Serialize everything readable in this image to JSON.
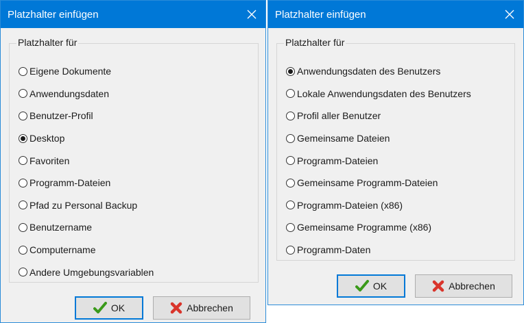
{
  "dialog_left": {
    "title": "Platzhalter einfügen",
    "group_label": "Platzhalter für",
    "options": [
      {
        "label": "Eigene Dokumente",
        "selected": false
      },
      {
        "label": "Anwendungsdaten",
        "selected": false
      },
      {
        "label": "Benutzer-Profil",
        "selected": false
      },
      {
        "label": "Desktop",
        "selected": true
      },
      {
        "label": "Favoriten",
        "selected": false
      },
      {
        "label": "Programm-Dateien",
        "selected": false
      },
      {
        "label": "Pfad zu Personal Backup",
        "selected": false
      },
      {
        "label": "Benutzername",
        "selected": false
      },
      {
        "label": "Computername",
        "selected": false
      },
      {
        "label": "Andere Umgebungsvariablen",
        "selected": false
      }
    ],
    "ok_label": "OK",
    "cancel_label": "Abbrechen"
  },
  "dialog_right": {
    "title": "Platzhalter einfügen",
    "group_label": "Platzhalter für",
    "options": [
      {
        "label": "Anwendungsdaten des Benutzers",
        "selected": true
      },
      {
        "label": "Lokale Anwendungsdaten des Benutzers",
        "selected": false
      },
      {
        "label": "Profil aller Benutzer",
        "selected": false
      },
      {
        "label": "Gemeinsame Dateien",
        "selected": false
      },
      {
        "label": "Programm-Dateien",
        "selected": false
      },
      {
        "label": "Gemeinsame Programm-Dateien",
        "selected": false
      },
      {
        "label": "Programm-Dateien (x86)",
        "selected": false
      },
      {
        "label": "Gemeinsame Programme (x86)",
        "selected": false
      },
      {
        "label": "Programm-Daten",
        "selected": false
      }
    ],
    "ok_label": "OK",
    "cancel_label": "Abbrechen"
  },
  "icons": {
    "close": "close-icon",
    "ok": "checkmark-icon",
    "cancel": "red-x-icon"
  },
  "colors": {
    "titlebar": "#0078d7",
    "accent_border": "#0078d7",
    "checkmark": "#3a9a1a",
    "cancel_x": "#d9342b"
  }
}
